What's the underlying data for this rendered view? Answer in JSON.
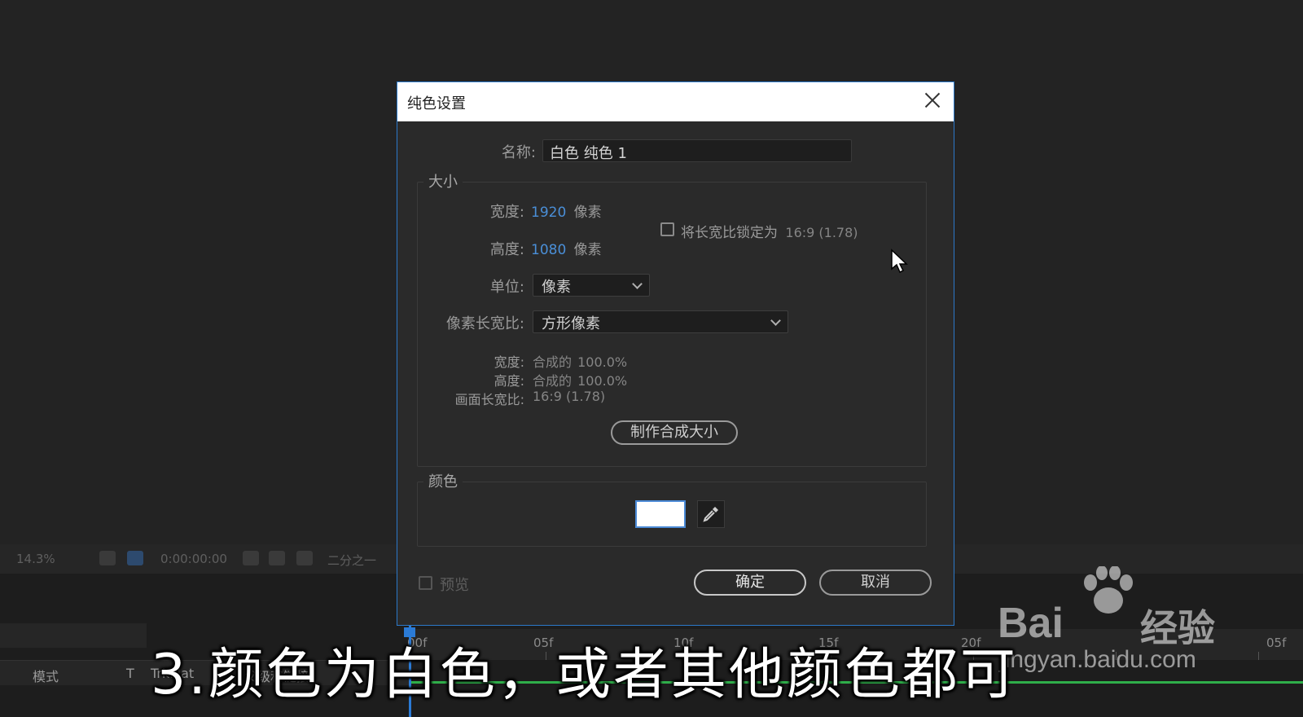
{
  "app": {
    "toolbar": {
      "zoom": "14.3%",
      "timecode": "0:00:00:00",
      "resolution": "二分之一"
    },
    "timeline": {
      "columns": [
        "模式",
        "T",
        "TrkMat",
        "父级和链接"
      ],
      "ruler": [
        "00f",
        "05f",
        "10f",
        "15f",
        "20f",
        "05f"
      ]
    }
  },
  "dialog": {
    "title": "纯色设置",
    "name_label": "名称:",
    "name_value": "白色 纯色 1",
    "size_group": "大小",
    "width_label": "宽度:",
    "width_value": "1920",
    "height_label": "高度:",
    "height_value": "1080",
    "px_unit": "像素",
    "lock_ratio_label": "将长宽比锁定为",
    "lock_ratio_value": "16:9 (1.78)",
    "unit_label": "单位:",
    "unit_value": "像素",
    "par_label": "像素长宽比:",
    "par_value": "方形像素",
    "info": {
      "width_label": "宽度:",
      "width_text": "合成的",
      "width_pct": "100.0%",
      "height_label": "高度:",
      "height_text": "合成的",
      "height_pct": "100.0%",
      "frame_label": "画面长宽比:",
      "frame_value": "16:9 (1.78)"
    },
    "make_comp_size": "制作合成大小",
    "color_group": "颜色",
    "color_value": "#ffffff",
    "preview_label": "预览",
    "ok_label": "确定",
    "cancel_label": "取消"
  },
  "overlay": {
    "caption": "3.颜色为白色，或者其他颜色都可",
    "watermark_brand": "Bai",
    "watermark_jy": "经验",
    "watermark_url": "jingyan.baidu.com"
  }
}
